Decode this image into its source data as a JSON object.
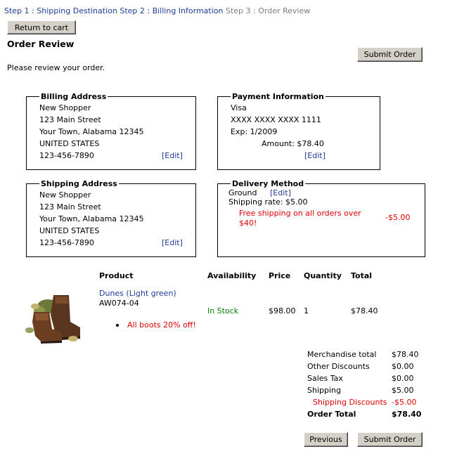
{
  "breadcrumb": {
    "step1": "Step 1 : Shipping Destination",
    "step2": "Step 2 : Billing Information",
    "step3": "Step 3 : Order Review"
  },
  "buttons": {
    "return_to_cart": "Return to cart",
    "submit_order_top": "Submit Order",
    "previous": "Previous",
    "submit_order_bottom": "Submit Order"
  },
  "page": {
    "title": "Order Review",
    "intro": "Please review your order."
  },
  "billing": {
    "legend": "Billing Address",
    "name": "New Shopper",
    "street": "123 Main Street",
    "city": "Your Town, Alabama 12345",
    "country": "UNITED STATES",
    "phone": "123-456-7890",
    "edit": "[Edit]"
  },
  "payment": {
    "legend": "Payment Information",
    "type": "Visa",
    "number": "XXXX XXXX XXXX 1111",
    "exp": "Exp: 1/2009",
    "amount": "Amount: $78.40",
    "edit": "[Edit]"
  },
  "shipping": {
    "legend": "Shipping Address",
    "name": "New Shopper",
    "street": "123 Main Street",
    "city": "Your Town, Alabama 12345",
    "country": "UNITED STATES",
    "phone": "123-456-7890",
    "edit": "[Edit]"
  },
  "delivery": {
    "legend": "Delivery Method",
    "method": "Ground",
    "edit": "[Edit]",
    "rate": "Shipping rate: $5.00",
    "promo_line1": "Free shipping on all orders over",
    "promo_line2": "$40!",
    "promo_amount": "-$5.00"
  },
  "product_table": {
    "headers": {
      "product": "Product",
      "availability": "Availability",
      "price": "Price",
      "quantity": "Quantity",
      "total": "Total"
    },
    "item": {
      "name": "Dunes (Light green)",
      "sku": "AW074-04",
      "availability": "In Stock",
      "price": "$98.00",
      "quantity": "1",
      "total": "$78.40",
      "promo": "All boots 20% off!",
      "image_icon": "boots-product-image"
    }
  },
  "totals": {
    "merch_label": "Merchandise total",
    "merch_value": "$78.40",
    "discount_label": "Other Discounts",
    "discount_value": "$0.00",
    "tax_label": "Sales Tax",
    "tax_value": "$0.00",
    "shipping_label": "Shipping",
    "shipping_value": "$5.00",
    "ship_discount_label": "Shipping Discounts",
    "ship_discount_value": "-$5.00",
    "order_total_label": "Order Total",
    "order_total_value": "$78.40"
  },
  "colors": {
    "link": "#1f3d99",
    "promo_red": "#e00000",
    "in_stock_green": "#008000",
    "button_face": "#d4d0c8"
  }
}
